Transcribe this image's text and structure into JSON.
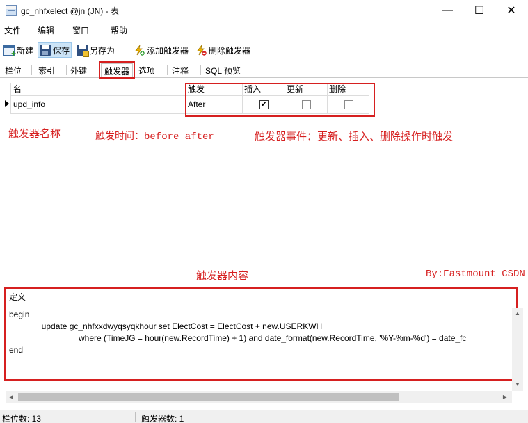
{
  "window": {
    "title": "gc_nhfxelect @jn (JN) - 表",
    "minimize": "—",
    "maximize": "☐",
    "close": "✕"
  },
  "menu": [
    "文件",
    "编辑",
    "窗口",
    "帮助"
  ],
  "toolbar": {
    "new": "新建",
    "save": "保存",
    "save_as": "另存为",
    "add_trigger": "添加触发器",
    "delete_trigger": "删除触发器"
  },
  "tabs": [
    "栏位",
    "索引",
    "外键",
    "触发器",
    "选项",
    "注释",
    "SQL 预览"
  ],
  "grid": {
    "columns": {
      "name": "名",
      "fire": "触发",
      "insert": "插入",
      "update": "更新",
      "delete": "删除"
    },
    "rows": [
      {
        "name": "upd_info",
        "fire": "After",
        "insert": true,
        "update": false,
        "delete": false
      }
    ]
  },
  "annotations": {
    "trigger_name": "触发器名称",
    "fire_time": "触发时间：before after",
    "events": "触发器事件：更新、插入、删除操作时触发",
    "content": "触发器内容",
    "byline": "By:Eastmount CSDN"
  },
  "definition": {
    "tab": "定义",
    "lines": [
      "begin",
      "              update gc_nhfxxdwyqsyqkhour set ElectCost = ElectCost + new.USERKWH",
      "                              where (TimeJG = hour(new.RecordTime) + 1) and date_format(new.RecordTime, '%Y-%m-%d') = date_fc",
      "end"
    ]
  },
  "status": {
    "fields": "栏位数: 13",
    "triggers": "触发器数: 1"
  },
  "colors": {
    "highlight": "#d62020",
    "tab_active_bg": "#ffffff"
  }
}
